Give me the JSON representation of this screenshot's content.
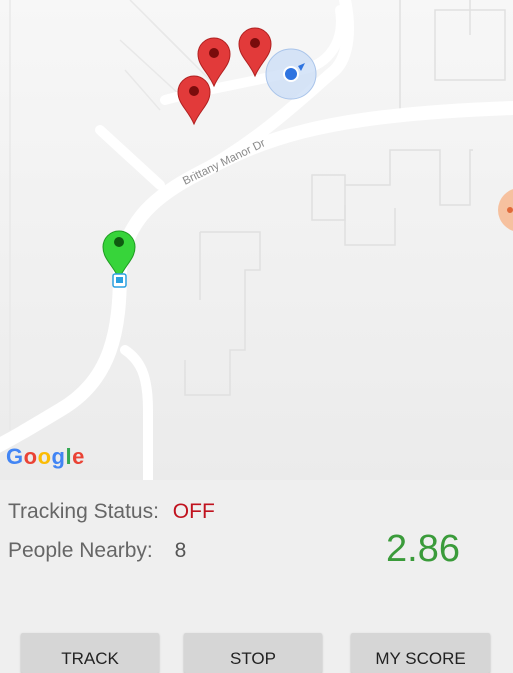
{
  "map": {
    "street_label": "Brittany Manor Dr",
    "attribution": "Google"
  },
  "status": {
    "tracking_label": "Tracking Status:",
    "tracking_value": "OFF",
    "nearby_label": "People Nearby:",
    "nearby_value": "8",
    "score": "2.86"
  },
  "buttons": {
    "track": "TRACK",
    "stop": "STOP",
    "my_score": "MY SCORE"
  },
  "colors": {
    "status_off": "#c0121e",
    "score": "#3a9b3a",
    "pin_red": "#e23a3a",
    "pin_green": "#37d43a",
    "location_dot": "#2f74e0"
  }
}
